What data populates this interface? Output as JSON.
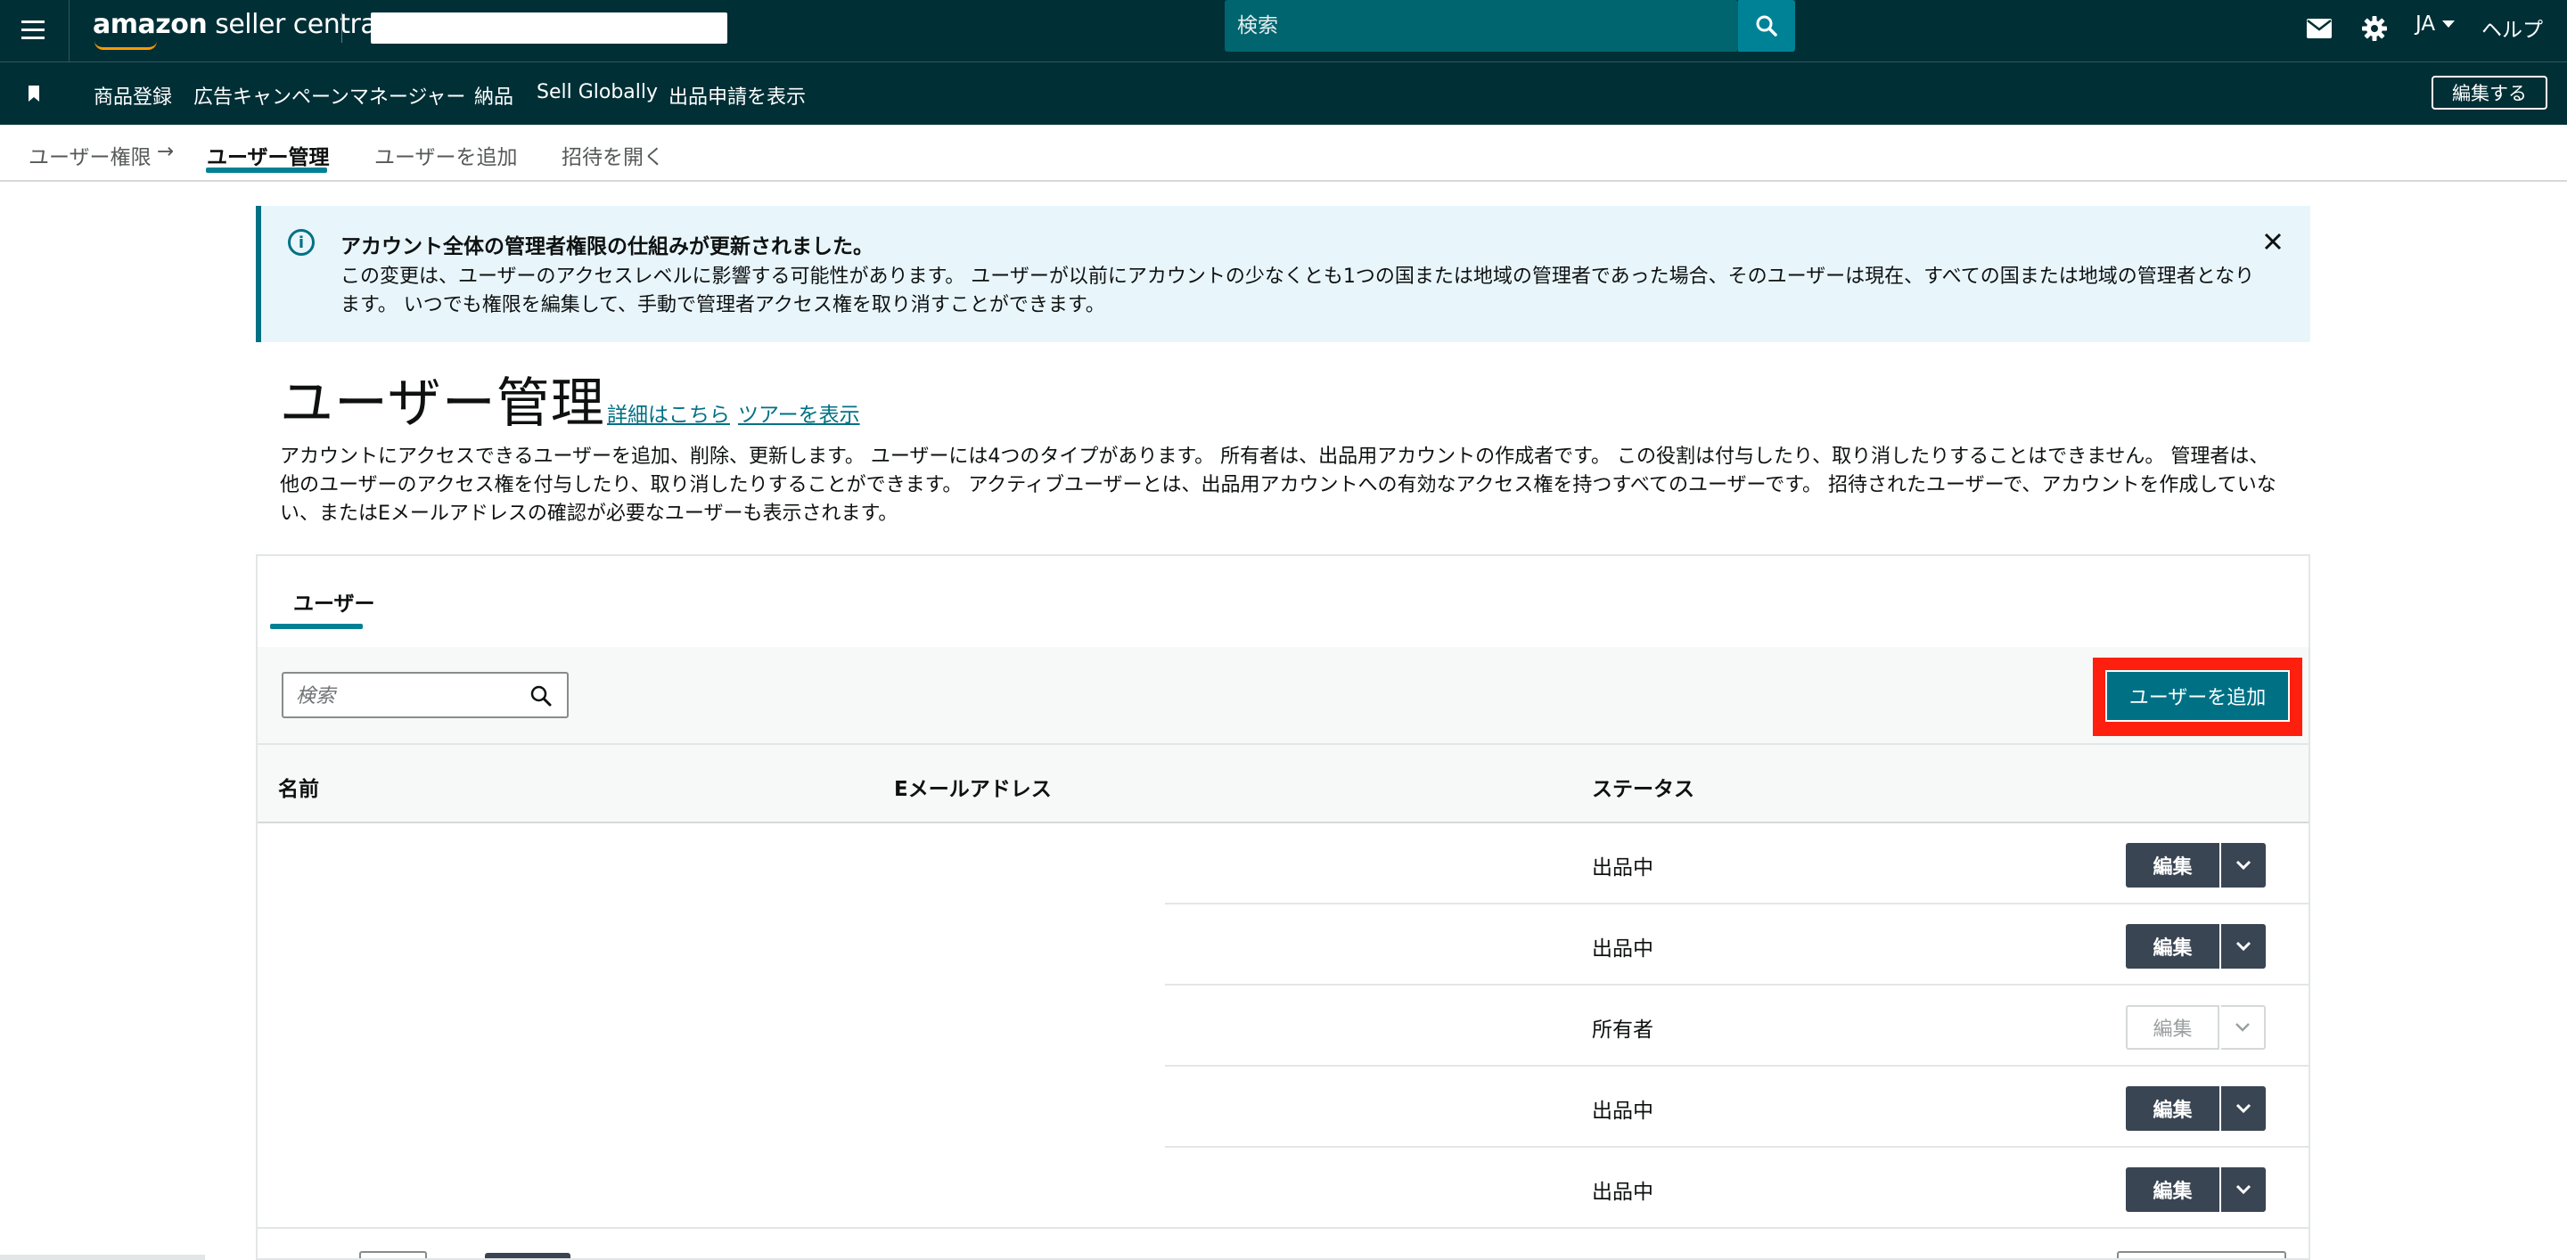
{
  "header": {
    "logo_text_bold": "amazon",
    "logo_text": " seller central",
    "search_placeholder": "検索",
    "language": "JA",
    "help": "ヘルプ"
  },
  "nav": {
    "items": [
      "商品登録",
      "広告キャンペーンマネージャー",
      "納品",
      "Sell Globally",
      "出品申請を表示"
    ],
    "edit_label": "編集する"
  },
  "breadcrumb": {
    "parent": "ユーザー権限",
    "current": "ユーザー管理",
    "add_user": "ユーザーを追加",
    "open_invites": "招待を開く"
  },
  "alert": {
    "title": "アカウント全体の管理者権限の仕組みが更新されました。",
    "body": "この変更は、ユーザーのアクセスレベルに影響する可能性があります。 ユーザーが以前にアカウントの少なくとも1つの国または地域の管理者であった場合、そのユーザーは現在、すべての国または地域の管理者となります。 いつでも権限を編集して、手動で管理者アクセス権を取り消すことができます。"
  },
  "main": {
    "title": "ユーザー管理",
    "learn_more": "詳細はこちら",
    "show_tour": "ツアーを表示",
    "description": "アカウントにアクセスできるユーザーを追加、削除、更新します。 ユーザーには4つのタイプがあります。 所有者は、出品用アカウントの作成者です。 この役割は付与したり、取り消したりすることはできません。 管理者は、他のユーザーのアクセス権を付与したり、取り消したりすることができます。 アクティブユーザーとは、出品用アカウントへの有効なアクセス権を持つすべてのユーザーです。 招待されたユーザーで、アカウントを作成していない、またはEメールアドレスの確認が必要なユーザーも表示されます。"
  },
  "users": {
    "tab": "ユーザー",
    "search_placeholder": "検索",
    "add_button": "ユーザーを追加",
    "columns": [
      "名前",
      "Eメールアドレス",
      "ステータス"
    ],
    "rows": [
      {
        "status": "出品中",
        "edit": "編集"
      },
      {
        "status": "出品中",
        "edit": "編集"
      },
      {
        "status": "所有者",
        "edit": "編集"
      },
      {
        "status": "出品中",
        "edit": "編集"
      },
      {
        "status": "出品中",
        "edit": "編集"
      }
    ]
  },
  "colors": {
    "header_bg": "#002f36",
    "accent": "#008296",
    "highlight": "#ff1f0f",
    "alert_bg": "#e8f6fc",
    "edit_button": "#3a4553"
  },
  "icons": [
    "menu-icon",
    "search-icon",
    "mail-icon",
    "gear-icon",
    "bookmark-icon",
    "info-icon",
    "close-icon",
    "chevron-down-icon"
  ]
}
